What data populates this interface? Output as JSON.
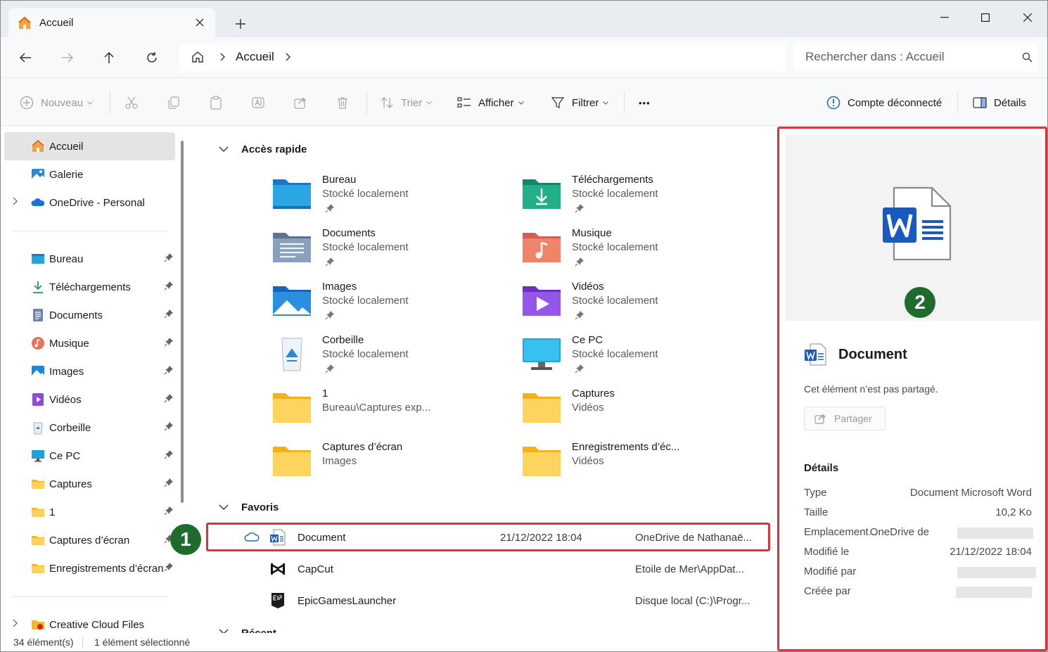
{
  "window": {
    "tab_title": "Accueil",
    "new_tab_symbol": "+"
  },
  "address": {
    "breadcrumb": "Accueil",
    "search_placeholder": "Rechercher dans : Accueil"
  },
  "toolbar": {
    "new_label": "Nouveau",
    "sort_label": "Trier",
    "view_label": "Afficher",
    "filter_label": "Filtrer",
    "more_label": "•••",
    "account_label": "Compte déconnecté",
    "details_label": "Détails"
  },
  "sidebar": {
    "top_items": [
      {
        "label": "Accueil",
        "icon": "home-icon",
        "selected": true
      },
      {
        "label": "Galerie",
        "icon": "gallery-icon"
      },
      {
        "label": "OneDrive - Personal",
        "icon": "onedrive-icon"
      }
    ],
    "pinned_items": [
      {
        "label": "Bureau",
        "icon": "desktop-folder-icon"
      },
      {
        "label": "Téléchargements",
        "icon": "download-icon"
      },
      {
        "label": "Documents",
        "icon": "documents-icon"
      },
      {
        "label": "Musique",
        "icon": "music-icon"
      },
      {
        "label": "Images",
        "icon": "pictures-icon"
      },
      {
        "label": "Vidéos",
        "icon": "videos-icon"
      },
      {
        "label": "Corbeille",
        "icon": "recycle-bin-icon"
      },
      {
        "label": "Ce PC",
        "icon": "this-pc-icon"
      },
      {
        "label": "Captures",
        "icon": "folder-icon"
      },
      {
        "label": "1",
        "icon": "folder-icon"
      },
      {
        "label": "Captures d’écran",
        "icon": "folder-icon"
      },
      {
        "label": "Enregistrements d’écran",
        "icon": "folder-icon"
      }
    ],
    "bottom_items": [
      {
        "label": "Creative Cloud Files",
        "icon": "creative-cloud-icon"
      }
    ]
  },
  "content": {
    "quick_access_title": "Accès rapide",
    "favorites_title": "Favoris",
    "recent_title": "Récent",
    "quick_access": [
      {
        "name": "Bureau",
        "sub": "Stocké localement",
        "pinned": true,
        "icon": "desktop-folder-icon"
      },
      {
        "name": "Téléchargements",
        "sub": "Stocké localement",
        "pinned": true,
        "icon": "downloads-folder-icon"
      },
      {
        "name": "Documents",
        "sub": "Stocké localement",
        "pinned": true,
        "icon": "documents-folder-icon"
      },
      {
        "name": "Musique",
        "sub": "Stocké localement",
        "pinned": true,
        "icon": "music-folder-icon"
      },
      {
        "name": "Images",
        "sub": "Stocké localement",
        "pinned": true,
        "icon": "pictures-folder-icon"
      },
      {
        "name": "Vidéos",
        "sub": "Stocké localement",
        "pinned": true,
        "icon": "videos-folder-icon"
      },
      {
        "name": "Corbeille",
        "sub": "Stocké localement",
        "pinned": true,
        "icon": "recycle-bin-icon"
      },
      {
        "name": "Ce PC",
        "sub": "Stocké localement",
        "pinned": true,
        "icon": "this-pc-icon"
      },
      {
        "name": "1",
        "sub": "Bureau\\Captures exp...",
        "pinned": false,
        "icon": "folder-icon"
      },
      {
        "name": "Captures",
        "sub": "Vidéos",
        "pinned": false,
        "icon": "folder-icon"
      },
      {
        "name": "Captures d’écran",
        "sub": "Images",
        "pinned": false,
        "icon": "folder-icon"
      },
      {
        "name": "Enregistrements d’éc...",
        "sub": "Vidéos",
        "pinned": false,
        "icon": "folder-icon"
      }
    ],
    "favorites": [
      {
        "name": "Document",
        "date": "21/12/2022 18:04",
        "location": "OneDrive de Nathanaë...",
        "icon": "word-file-icon",
        "cloud": true
      },
      {
        "name": "CapCut",
        "date": "",
        "location": "Etoile de Mer\\AppDat...",
        "icon": "capcut-icon",
        "cloud": false
      },
      {
        "name": "EpicGamesLauncher",
        "date": "",
        "location": "Disque local (C:)\\Progr...",
        "icon": "epic-games-icon",
        "cloud": false
      }
    ]
  },
  "details_pane": {
    "file_title": "Document",
    "shared_text": "Cet élément n’est pas partagé.",
    "share_button": "Partager",
    "details_heading": "Détails",
    "rows": [
      {
        "key": "Type",
        "value": "Document Microsoft Word"
      },
      {
        "key": "Taille",
        "value": "10,2 Ko"
      },
      {
        "key": "Emplacement...",
        "value": "OneDrive de"
      },
      {
        "key": "Modifié le",
        "value": "21/12/2022 18:04"
      },
      {
        "key": "Modifié par",
        "value": ""
      },
      {
        "key": "Créée par",
        "value": ""
      }
    ]
  },
  "status": {
    "item_count": "34 élément(s)",
    "selection": "1 élément sélectionné"
  },
  "annotations": {
    "badge_1": "1",
    "badge_2": "2"
  },
  "colors": {
    "highlight": "#d9333f",
    "badge": "#1e6b2e",
    "word_blue": "#185abd",
    "folder_yellow": "#f7c948"
  }
}
